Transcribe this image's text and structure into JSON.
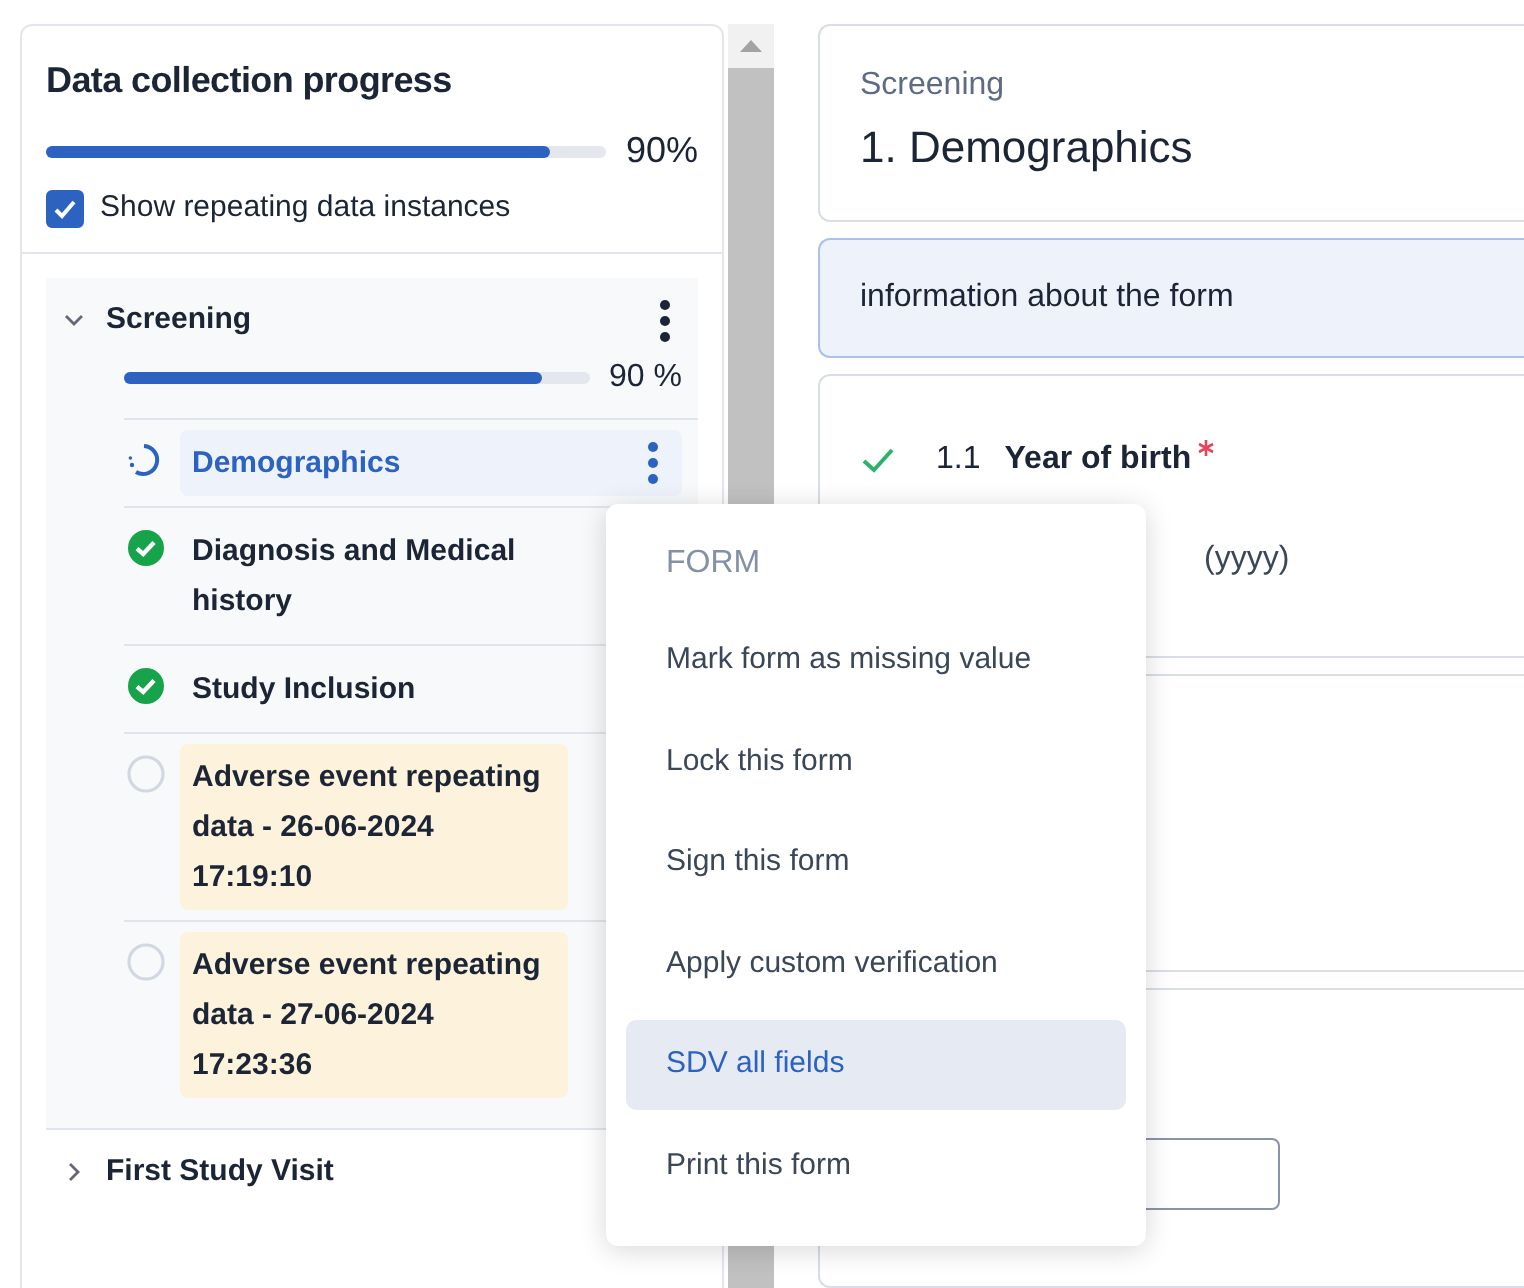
{
  "progress_panel": {
    "title": "Data collection progress",
    "level": 0.9,
    "percent": "90%",
    "show_repeating": {
      "label": "Show repeating data instances",
      "checked": true
    }
  },
  "events": [
    {
      "name": "Screening",
      "expanded": true,
      "level": 0.9,
      "percent": "90 %",
      "forms": [
        {
          "name": "Demographics",
          "kind": "in_progress",
          "selected": true,
          "repeating": false
        },
        {
          "name": "Diagnosis and Medical history",
          "kind": "complete",
          "selected": false,
          "repeating": false
        },
        {
          "name": "Study Inclusion",
          "kind": "complete",
          "selected": false,
          "repeating": false
        },
        {
          "name": "Adverse event repeating data - 26-06-2024 17:19:10",
          "kind": "not_started",
          "selected": false,
          "repeating": true
        },
        {
          "name": "Adverse event repeating data - 27-06-2024 17:23:36",
          "kind": "not_started",
          "selected": false,
          "repeating": true
        }
      ]
    },
    {
      "name": "First Study Visit",
      "expanded": false
    }
  ],
  "form_header": {
    "event": "Screening",
    "title": "1. Demographics"
  },
  "info": "information about the form",
  "questions": [
    {
      "number": "1.1",
      "label": "Year of birth",
      "required": true,
      "valid": true,
      "hint": "(yyyy)"
    }
  ],
  "context_menu": {
    "heading": "FORM",
    "items": [
      {
        "label": "Mark form as missing value",
        "selected": false
      },
      {
        "label": "Lock this form",
        "selected": false
      },
      {
        "label": "Sign this form",
        "selected": false
      },
      {
        "label": "Apply custom verification",
        "selected": false
      },
      {
        "label": "SDV all fields",
        "selected": true
      },
      {
        "label": "Print this form",
        "selected": false
      }
    ]
  }
}
